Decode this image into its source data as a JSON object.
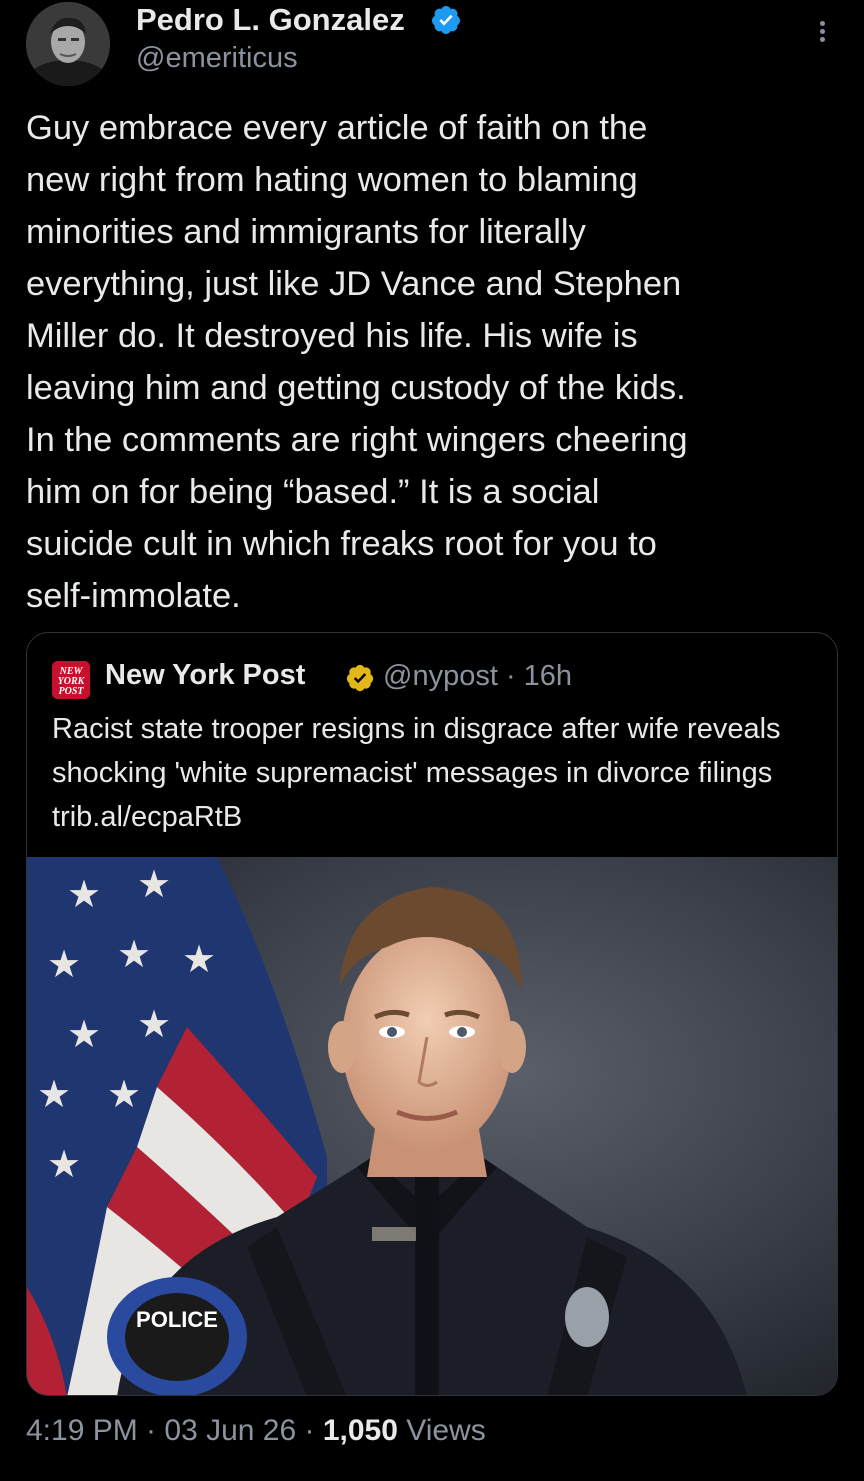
{
  "author": {
    "display_name": "Pedro L. Gonzalez",
    "handle": "@emeriticus",
    "verified_icon": "verified-badge-blue"
  },
  "tweet": {
    "text": "Guy embrace every article of faith on the\nnew right from hating women to blaming\nminorities and immigrants for literally\neverything, just like JD Vance and Stephen\nMiller do. It destroyed his life. His wife is\nleaving him and getting custody of the kids.\nIn the comments are right wingers cheering\nhim on for being “based.” It is a social\nsuicide cult in which freaks root for you to\nself-immolate."
  },
  "quote": {
    "name": "New York Post",
    "badge_icon": "verified-badge-gold",
    "handle_time": "@nypost · 16h",
    "text": "Racist state trooper resigns in disgrace after wife reveals shocking 'white supremacist' messages in divorce filings trib.al/ecpaRtB",
    "logo_icon": "nypost-logo"
  },
  "meta": {
    "time_date": "4:19 PM · 03 Jun 26 · ",
    "views_count": "1,050",
    "views_label": " Views"
  },
  "colors": {
    "background": "#000000",
    "text_primary": "#e7e9ea",
    "text_secondary": "#8b949e",
    "verified_blue": "#1d9bf0",
    "verified_gold": "#e2b719",
    "nypost_red": "#c8102e"
  }
}
